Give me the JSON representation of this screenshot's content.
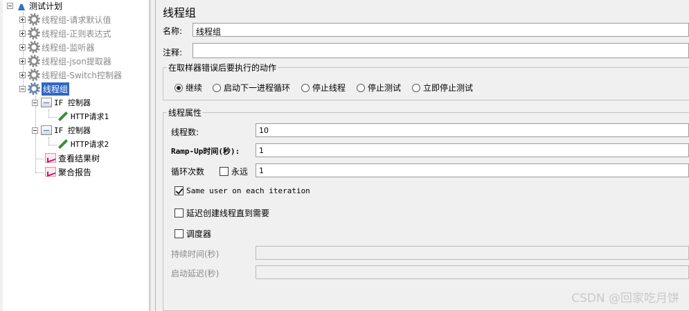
{
  "tree": {
    "root": {
      "label": "测试计划",
      "icon": "flask-icon"
    },
    "items": [
      {
        "label": "线程组-请求默认值",
        "icon": "gear-icon",
        "disabled": true
      },
      {
        "label": "线程组-正则表达式",
        "icon": "gear-icon",
        "disabled": true
      },
      {
        "label": "线程组-监听器",
        "icon": "gear-icon",
        "disabled": true
      },
      {
        "label": "线程组-json提取器",
        "icon": "gear-icon",
        "disabled": true
      },
      {
        "label": "线程组-Switch控制器",
        "icon": "gear-icon",
        "disabled": true
      },
      {
        "label": "线程组",
        "icon": "gear-icon",
        "selected": true
      }
    ],
    "children": [
      {
        "label": "IF 控制器",
        "icon": "if-controller-icon"
      },
      {
        "label": "HTTP请求1",
        "icon": "sampler-icon"
      },
      {
        "label": "IF 控制器",
        "icon": "if-controller-icon"
      },
      {
        "label": "HTTP请求2",
        "icon": "sampler-icon"
      },
      {
        "label": "查看结果树",
        "icon": "listener-icon"
      },
      {
        "label": "聚合报告",
        "icon": "listener-icon"
      }
    ]
  },
  "panel": {
    "title": "线程组",
    "name_label": "名称:",
    "name_value": "线程组",
    "comment_label": "注释:",
    "comment_value": "",
    "error_group": {
      "title": "在取样器错误后要执行的动作",
      "options": [
        "继续",
        "启动下一进程循环",
        "停止线程",
        "停止测试",
        "立即停止测试"
      ],
      "selected": 0
    },
    "thread_group": {
      "title": "线程属性",
      "threads_label": "线程数:",
      "threads_value": "10",
      "rampup_label": "Ramp-Up时间(秒):",
      "rampup_value": "1",
      "loop_label": "循环次数",
      "forever_label": "永远",
      "forever_checked": false,
      "loop_value": "1",
      "same_user_label": "Same user on each iteration",
      "same_user_checked": true,
      "delay_label": "延迟创建线程直到需要",
      "delay_checked": false,
      "scheduler_label": "调度器",
      "scheduler_checked": false,
      "duration_label": "持续时间(秒)",
      "duration_value": "",
      "startup_delay_label": "启动延迟(秒)",
      "startup_delay_value": ""
    }
  },
  "watermark": "CSDN @回家吃月饼",
  "colors": {
    "selection": "#3165c4",
    "background": "#f0f0f0"
  }
}
